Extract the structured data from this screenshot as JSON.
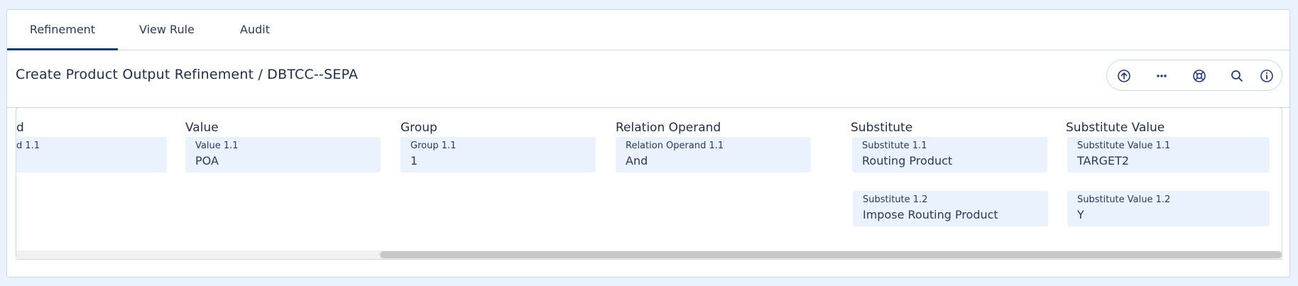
{
  "tabs": [
    {
      "label": "Refinement",
      "active": true
    },
    {
      "label": "View Rule",
      "active": false
    },
    {
      "label": "Audit",
      "active": false
    }
  ],
  "page": {
    "title": "Create Product Output Refinement / DBTCC--SEPA"
  },
  "toolbar": {
    "icons": [
      "upload-circle-icon",
      "more-horizontal-icon",
      "help-lifebuoy-icon",
      "search-icon",
      "info-icon"
    ]
  },
  "grid": {
    "columns": [
      {
        "header": "d"
      },
      {
        "header": "Value"
      },
      {
        "header": "Group"
      },
      {
        "header": "Relation Operand"
      },
      {
        "header": "Substitute"
      },
      {
        "header": "Substitute Value"
      }
    ],
    "rows": [
      {
        "cells": [
          {
            "label": "d 1.1",
            "value": ""
          },
          {
            "label": "Value 1.1",
            "value": "POA"
          },
          {
            "label": "Group 1.1",
            "value": "1"
          },
          {
            "label": "Relation Operand 1.1",
            "value": "And"
          },
          {
            "label": "Substitute 1.1",
            "value": "Routing Product"
          },
          {
            "label": "Substitute Value 1.1",
            "value": "TARGET2"
          }
        ]
      },
      {
        "cells": [
          {
            "label": "Substitute 1.2",
            "value": "Impose Routing Product"
          },
          {
            "label": "Substitute Value 1.2",
            "value": "Y"
          }
        ]
      }
    ],
    "scroll_position": 0.3
  },
  "colors": {
    "accent": "#1e3a7a",
    "cell_background": "#eaf2fd",
    "border": "#c9d8ee"
  }
}
